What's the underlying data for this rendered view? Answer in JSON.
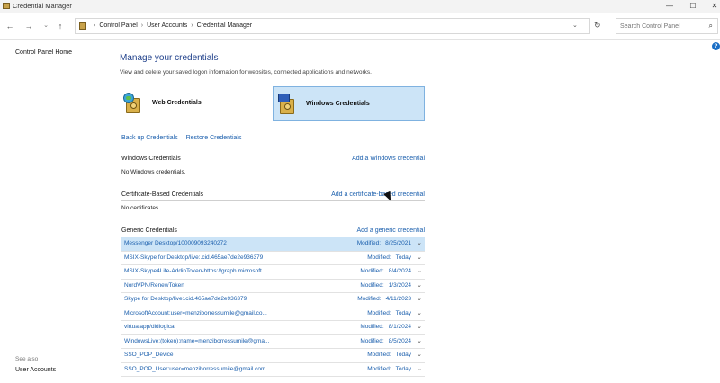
{
  "window": {
    "title": "Credential Manager",
    "controls": {
      "minimize": "—",
      "maximize": "☐",
      "close": "✕"
    }
  },
  "navbar": {
    "breadcrumbs": [
      "Control Panel",
      "User Accounts",
      "Credential Manager"
    ],
    "search_placeholder": "Search Control Panel"
  },
  "sidebar": {
    "home": "Control Panel Home",
    "see_also": "See also",
    "user_accounts": "User Accounts"
  },
  "main": {
    "heading": "Manage your credentials",
    "description": "View and delete your saved logon information for websites, connected applications and networks.",
    "tiles": {
      "web": "Web Credentials",
      "windows": "Windows Credentials",
      "selected": "windows"
    },
    "links": {
      "backup": "Back up Credentials",
      "restore": "Restore Credentials"
    },
    "windows_section": {
      "title": "Windows Credentials",
      "add": "Add a Windows credential",
      "empty": "No Windows credentials."
    },
    "cert_section": {
      "title": "Certificate-Based Credentials",
      "add": "Add a certificate-based credential",
      "empty": "No certificates."
    },
    "generic_section": {
      "title": "Generic Credentials",
      "add": "Add a generic credential"
    },
    "modified_label": "Modified:",
    "generic_credentials": [
      {
        "name": "Messenger Desktop/100009093240272",
        "modified": "8/25/2021",
        "selected": true
      },
      {
        "name": "MSIX-Skype for Desktop/live:.cid.465ae7de2e936379",
        "modified": "Today"
      },
      {
        "name": "MSIX-Skype4Life-AddinToken-https://graph.microsoft...",
        "modified": "8/4/2024"
      },
      {
        "name": "NordVPN/RenewToken",
        "modified": "1/3/2024"
      },
      {
        "name": "Skype for Desktop/live:.cid.465ae7de2e936379",
        "modified": "4/11/2023"
      },
      {
        "name": "MicrosoftAccount:user=menziborressumile@gmail.co...",
        "modified": "Today"
      },
      {
        "name": "virtualapp/didlogical",
        "modified": "8/1/2024"
      },
      {
        "name": "WindowsLive:(token):name=menziborressumile@gma...",
        "modified": "8/5/2024"
      },
      {
        "name": "SSO_POP_Device",
        "modified": "Today"
      },
      {
        "name": "SSO_POP_User:user=menziborressumile@gmail.com",
        "modified": "Today"
      }
    ]
  },
  "colors": {
    "link": "#1b5fad",
    "heading": "#1e3f8a",
    "selected_bg": "#cce4f7"
  }
}
